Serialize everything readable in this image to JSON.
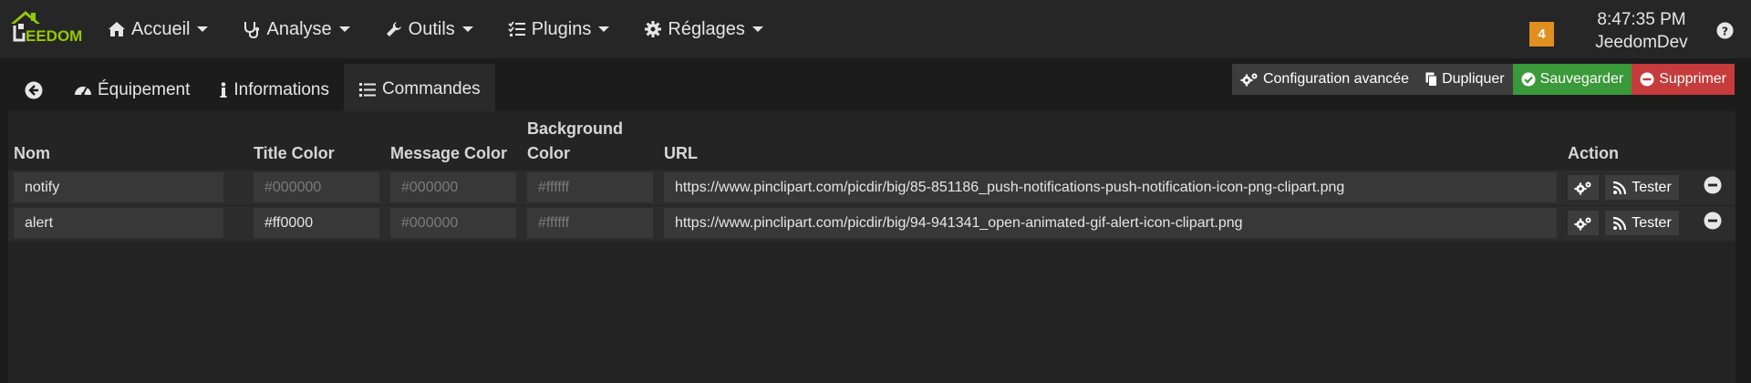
{
  "app": {
    "brand": "EEDOM"
  },
  "nav": {
    "items": [
      {
        "label": "Accueil",
        "icon": "home-icon"
      },
      {
        "label": "Analyse",
        "icon": "stethoscope-icon"
      },
      {
        "label": "Outils",
        "icon": "wrench-icon"
      },
      {
        "label": "Plugins",
        "icon": "tasks-icon"
      },
      {
        "label": "Réglages",
        "icon": "gear-icon"
      }
    ],
    "badge_count": "4",
    "time": "8:47:35 PM",
    "user": "JeedomDev"
  },
  "tabs": [
    {
      "label": "",
      "icon": "back-arrow-icon"
    },
    {
      "label": "Équipement",
      "icon": "tachometer-icon"
    },
    {
      "label": "Informations",
      "icon": "info-icon"
    },
    {
      "label": "Commandes",
      "icon": "list-icon",
      "active": true
    }
  ],
  "actions": {
    "config": "Configuration avancée",
    "duplicate": "Dupliquer",
    "save": "Sauvegarder",
    "delete": "Supprimer"
  },
  "table": {
    "headers": {
      "nom": "Nom",
      "title_color": "Title Color",
      "message_color": "Message Color",
      "bg_color_1": "Background",
      "bg_color_2": "Color",
      "url": "URL",
      "action": "Action"
    },
    "rows": [
      {
        "nom": "notify",
        "title_color": "#000000",
        "title_color_is_value": false,
        "message_color": "#000000",
        "background_color": "#ffffff",
        "url": "https://www.pinclipart.com/picdir/big/85-851186_push-notifications-push-notification-icon-png-clipart.png",
        "test_label": "Tester"
      },
      {
        "nom": "alert",
        "title_color": "#ff0000",
        "title_color_is_value": true,
        "message_color": "#000000",
        "background_color": "#ffffff",
        "url": "https://www.pinclipart.com/picdir/big/94-941341_open-animated-gif-alert-icon-clipart.png",
        "test_label": "Tester"
      }
    ]
  },
  "colors": {
    "accent": "#94ca02",
    "badge": "#e18f1e",
    "save": "#3a9a3a",
    "delete": "#c63b3b"
  }
}
